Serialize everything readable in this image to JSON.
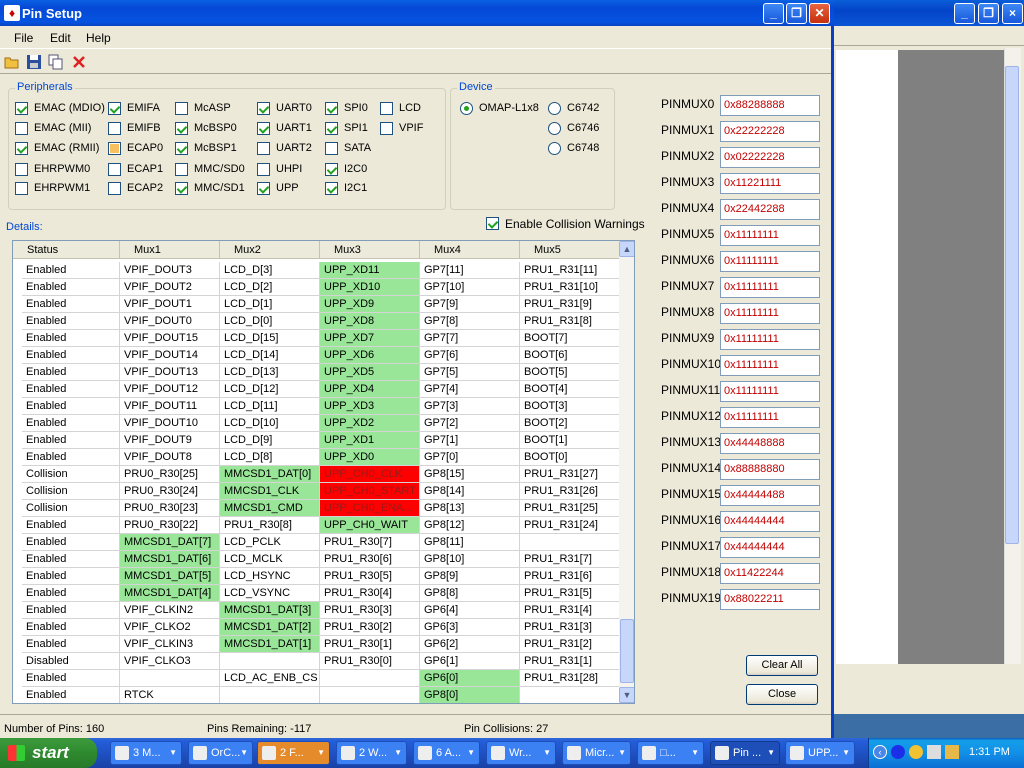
{
  "window": {
    "title": "Pin Setup"
  },
  "menu": {
    "items": [
      "File",
      "Edit",
      "Help"
    ]
  },
  "toolbar": {
    "icons": [
      "open-icon",
      "save-icon",
      "copy-icon",
      "delete-icon"
    ]
  },
  "peripherals": {
    "title": "Peripherals",
    "items": [
      {
        "label": "EMAC (MDIO)",
        "state": "checked"
      },
      {
        "label": "EMIFA",
        "state": "checked"
      },
      {
        "label": "McASP",
        "state": "unchecked"
      },
      {
        "label": "UART0",
        "state": "checked"
      },
      {
        "label": "SPI0",
        "state": "checked"
      },
      {
        "label": "LCD",
        "state": "unchecked"
      },
      {
        "label": "EMAC (MII)",
        "state": "unchecked"
      },
      {
        "label": "EMIFB",
        "state": "unchecked"
      },
      {
        "label": "McBSP0",
        "state": "checked"
      },
      {
        "label": "UART1",
        "state": "checked"
      },
      {
        "label": "SPI1",
        "state": "checked"
      },
      {
        "label": "VPIF",
        "state": "unchecked"
      },
      {
        "label": "EMAC (RMII)",
        "state": "checked"
      },
      {
        "label": "ECAP0",
        "state": "indeterminate"
      },
      {
        "label": "McBSP1",
        "state": "checked"
      },
      {
        "label": "UART2",
        "state": "unchecked"
      },
      {
        "label": "SATA",
        "state": "unchecked"
      },
      {
        "label": "EHRPWM0",
        "state": "unchecked"
      },
      {
        "label": "ECAP1",
        "state": "unchecked"
      },
      {
        "label": "MMC/SD0",
        "state": "unchecked"
      },
      {
        "label": "UHPI",
        "state": "unchecked"
      },
      {
        "label": "I2C0",
        "state": "checked"
      },
      {
        "label": "EHRPWM1",
        "state": "unchecked"
      },
      {
        "label": "ECAP2",
        "state": "unchecked"
      },
      {
        "label": "MMC/SD1",
        "state": "checked"
      },
      {
        "label": "UPP",
        "state": "checked"
      },
      {
        "label": "I2C1",
        "state": "checked"
      }
    ]
  },
  "device": {
    "title": "Device",
    "options": [
      {
        "label": "OMAP-L1x8",
        "selected": true
      },
      {
        "label": "C6742",
        "selected": false
      },
      {
        "label": "C6746",
        "selected": false
      },
      {
        "label": "C6748",
        "selected": false
      }
    ]
  },
  "details": {
    "label": "Details:"
  },
  "collision": {
    "label": "Enable Collision Warnings",
    "checked": true
  },
  "grid": {
    "headers": [
      "Status",
      "Mux1",
      "Mux2",
      "Mux3",
      "Mux4",
      "Mux5"
    ],
    "rows": [
      [
        [
          "Enabled",
          ""
        ],
        [
          "VPIF_DOUT3",
          ""
        ],
        [
          "LCD_D[3]",
          ""
        ],
        [
          "UPP_XD11",
          "g"
        ],
        [
          "GP7[11]",
          ""
        ],
        [
          "PRU1_R31[11]",
          ""
        ]
      ],
      [
        [
          "Enabled",
          ""
        ],
        [
          "VPIF_DOUT2",
          ""
        ],
        [
          "LCD_D[2]",
          ""
        ],
        [
          "UPP_XD10",
          "g"
        ],
        [
          "GP7[10]",
          ""
        ],
        [
          "PRU1_R31[10]",
          ""
        ]
      ],
      [
        [
          "Enabled",
          ""
        ],
        [
          "VPIF_DOUT1",
          ""
        ],
        [
          "LCD_D[1]",
          ""
        ],
        [
          "UPP_XD9",
          "g"
        ],
        [
          "GP7[9]",
          ""
        ],
        [
          "PRU1_R31[9]",
          ""
        ]
      ],
      [
        [
          "Enabled",
          ""
        ],
        [
          "VPIF_DOUT0",
          ""
        ],
        [
          "LCD_D[0]",
          ""
        ],
        [
          "UPP_XD8",
          "g"
        ],
        [
          "GP7[8]",
          ""
        ],
        [
          "PRU1_R31[8]",
          ""
        ]
      ],
      [
        [
          "Enabled",
          ""
        ],
        [
          "VPIF_DOUT15",
          ""
        ],
        [
          "LCD_D[15]",
          ""
        ],
        [
          "UPP_XD7",
          "g"
        ],
        [
          "GP7[7]",
          ""
        ],
        [
          "BOOT[7]",
          ""
        ]
      ],
      [
        [
          "Enabled",
          ""
        ],
        [
          "VPIF_DOUT14",
          ""
        ],
        [
          "LCD_D[14]",
          ""
        ],
        [
          "UPP_XD6",
          "g"
        ],
        [
          "GP7[6]",
          ""
        ],
        [
          "BOOT[6]",
          ""
        ]
      ],
      [
        [
          "Enabled",
          ""
        ],
        [
          "VPIF_DOUT13",
          ""
        ],
        [
          "LCD_D[13]",
          ""
        ],
        [
          "UPP_XD5",
          "g"
        ],
        [
          "GP7[5]",
          ""
        ],
        [
          "BOOT[5]",
          ""
        ]
      ],
      [
        [
          "Enabled",
          ""
        ],
        [
          "VPIF_DOUT12",
          ""
        ],
        [
          "LCD_D[12]",
          ""
        ],
        [
          "UPP_XD4",
          "g"
        ],
        [
          "GP7[4]",
          ""
        ],
        [
          "BOOT[4]",
          ""
        ]
      ],
      [
        [
          "Enabled",
          ""
        ],
        [
          "VPIF_DOUT11",
          ""
        ],
        [
          "LCD_D[11]",
          ""
        ],
        [
          "UPP_XD3",
          "g"
        ],
        [
          "GP7[3]",
          ""
        ],
        [
          "BOOT[3]",
          ""
        ]
      ],
      [
        [
          "Enabled",
          ""
        ],
        [
          "VPIF_DOUT10",
          ""
        ],
        [
          "LCD_D[10]",
          ""
        ],
        [
          "UPP_XD2",
          "g"
        ],
        [
          "GP7[2]",
          ""
        ],
        [
          "BOOT[2]",
          ""
        ]
      ],
      [
        [
          "Enabled",
          ""
        ],
        [
          "VPIF_DOUT9",
          ""
        ],
        [
          "LCD_D[9]",
          ""
        ],
        [
          "UPP_XD1",
          "g"
        ],
        [
          "GP7[1]",
          ""
        ],
        [
          "BOOT[1]",
          ""
        ]
      ],
      [
        [
          "Enabled",
          ""
        ],
        [
          "VPIF_DOUT8",
          ""
        ],
        [
          "LCD_D[8]",
          ""
        ],
        [
          "UPP_XD0",
          "g"
        ],
        [
          "GP7[0]",
          ""
        ],
        [
          "BOOT[0]",
          ""
        ]
      ],
      [
        [
          "Collision",
          ""
        ],
        [
          "PRU0_R30[25]",
          ""
        ],
        [
          "MMCSD1_DAT[0]",
          "g"
        ],
        [
          "UPP_CH0_CLK",
          "r"
        ],
        [
          "GP8[15]",
          ""
        ],
        [
          "PRU1_R31[27]",
          ""
        ]
      ],
      [
        [
          "Collision",
          ""
        ],
        [
          "PRU0_R30[24]",
          ""
        ],
        [
          "MMCSD1_CLK",
          "g"
        ],
        [
          "UPP_CH0_START",
          "r"
        ],
        [
          "GP8[14]",
          ""
        ],
        [
          "PRU1_R31[26]",
          ""
        ]
      ],
      [
        [
          "Collision",
          ""
        ],
        [
          "PRU0_R30[23]",
          ""
        ],
        [
          "MMCSD1_CMD",
          "g"
        ],
        [
          "UPP_CH0_ENA...",
          "r"
        ],
        [
          "GP8[13]",
          ""
        ],
        [
          "PRU1_R31[25]",
          ""
        ]
      ],
      [
        [
          "Enabled",
          ""
        ],
        [
          "PRU0_R30[22]",
          ""
        ],
        [
          "PRU1_R30[8]",
          ""
        ],
        [
          "UPP_CH0_WAIT",
          "g"
        ],
        [
          "GP8[12]",
          ""
        ],
        [
          "PRU1_R31[24]",
          ""
        ]
      ],
      [
        [
          "Enabled",
          ""
        ],
        [
          "MMCSD1_DAT[7]",
          "g"
        ],
        [
          "LCD_PCLK",
          ""
        ],
        [
          "PRU1_R30[7]",
          ""
        ],
        [
          "GP8[11]",
          ""
        ],
        [
          "",
          ""
        ]
      ],
      [
        [
          "Enabled",
          ""
        ],
        [
          "MMCSD1_DAT[6]",
          "g"
        ],
        [
          "LCD_MCLK",
          ""
        ],
        [
          "PRU1_R30[6]",
          ""
        ],
        [
          "GP8[10]",
          ""
        ],
        [
          "PRU1_R31[7]",
          ""
        ]
      ],
      [
        [
          "Enabled",
          ""
        ],
        [
          "MMCSD1_DAT[5]",
          "g"
        ],
        [
          "LCD_HSYNC",
          ""
        ],
        [
          "PRU1_R30[5]",
          ""
        ],
        [
          "GP8[9]",
          ""
        ],
        [
          "PRU1_R31[6]",
          ""
        ]
      ],
      [
        [
          "Enabled",
          ""
        ],
        [
          "MMCSD1_DAT[4]",
          "g"
        ],
        [
          "LCD_VSYNC",
          ""
        ],
        [
          "PRU1_R30[4]",
          ""
        ],
        [
          "GP8[8]",
          ""
        ],
        [
          "PRU1_R31[5]",
          ""
        ]
      ],
      [
        [
          "Enabled",
          ""
        ],
        [
          "VPIF_CLKIN2",
          ""
        ],
        [
          "MMCSD1_DAT[3]",
          "g"
        ],
        [
          "PRU1_R30[3]",
          ""
        ],
        [
          "GP6[4]",
          ""
        ],
        [
          "PRU1_R31[4]",
          ""
        ]
      ],
      [
        [
          "Enabled",
          ""
        ],
        [
          "VPIF_CLKO2",
          ""
        ],
        [
          "MMCSD1_DAT[2]",
          "g"
        ],
        [
          "PRU1_R30[2]",
          ""
        ],
        [
          "GP6[3]",
          ""
        ],
        [
          "PRU1_R31[3]",
          ""
        ]
      ],
      [
        [
          "Enabled",
          ""
        ],
        [
          "VPIF_CLKIN3",
          ""
        ],
        [
          "MMCSD1_DAT[1]",
          "g"
        ],
        [
          "PRU1_R30[1]",
          ""
        ],
        [
          "GP6[2]",
          ""
        ],
        [
          "PRU1_R31[2]",
          ""
        ]
      ],
      [
        [
          "Disabled",
          ""
        ],
        [
          "VPIF_CLKO3",
          ""
        ],
        [
          "",
          ""
        ],
        [
          "PRU1_R30[0]",
          ""
        ],
        [
          "GP6[1]",
          ""
        ],
        [
          "PRU1_R31[1]",
          ""
        ]
      ],
      [
        [
          "Enabled",
          ""
        ],
        [
          "",
          ""
        ],
        [
          "LCD_AC_ENB_CS",
          ""
        ],
        [
          "",
          ""
        ],
        [
          "GP6[0]",
          "g"
        ],
        [
          "PRU1_R31[28]",
          ""
        ]
      ],
      [
        [
          "Enabled",
          ""
        ],
        [
          "RTCK",
          ""
        ],
        [
          "",
          ""
        ],
        [
          "",
          ""
        ],
        [
          "GP8[0]",
          "g"
        ],
        [
          "",
          ""
        ]
      ]
    ]
  },
  "pinmux": [
    {
      "label": "PINMUX0",
      "value": "0x88288888"
    },
    {
      "label": "PINMUX1",
      "value": "0x22222228"
    },
    {
      "label": "PINMUX2",
      "value": "0x02222228"
    },
    {
      "label": "PINMUX3",
      "value": "0x11221111"
    },
    {
      "label": "PINMUX4",
      "value": "0x22442288"
    },
    {
      "label": "PINMUX5",
      "value": "0x11111111"
    },
    {
      "label": "PINMUX6",
      "value": "0x11111111"
    },
    {
      "label": "PINMUX7",
      "value": "0x11111111"
    },
    {
      "label": "PINMUX8",
      "value": "0x11111111"
    },
    {
      "label": "PINMUX9",
      "value": "0x11111111"
    },
    {
      "label": "PINMUX10",
      "value": "0x11111111"
    },
    {
      "label": "PINMUX11",
      "value": "0x11111111"
    },
    {
      "label": "PINMUX12",
      "value": "0x11111111"
    },
    {
      "label": "PINMUX13",
      "value": "0x44448888"
    },
    {
      "label": "PINMUX14",
      "value": "0x88888880"
    },
    {
      "label": "PINMUX15",
      "value": "0x44444488"
    },
    {
      "label": "PINMUX16",
      "value": "0x44444444"
    },
    {
      "label": "PINMUX17",
      "value": "0x44444444"
    },
    {
      "label": "PINMUX18",
      "value": "0x11422244"
    },
    {
      "label": "PINMUX19",
      "value": "0x88022211"
    }
  ],
  "buttons": {
    "clear_all": "Clear All",
    "close": "Close"
  },
  "status": {
    "pins": "Number of Pins: 160",
    "remaining": "Pins Remaining: -117",
    "collisions": "Pin Collisions: 27"
  },
  "taskbar": {
    "start": "start",
    "tasks": [
      {
        "label": "3 M...",
        "icon": "folder-icon",
        "active": false,
        "orange": false
      },
      {
        "label": "OrC...",
        "icon": "app-icon",
        "active": false,
        "orange": false
      },
      {
        "label": "2 F...",
        "icon": "firefox-icon",
        "active": false,
        "orange": true
      },
      {
        "label": "2 W...",
        "icon": "folder-icon",
        "active": false,
        "orange": false
      },
      {
        "label": "6 A...",
        "icon": "pdf-icon",
        "active": false,
        "orange": false
      },
      {
        "label": "Wr...",
        "icon": "app-icon",
        "active": false,
        "orange": false
      },
      {
        "label": "Micr...",
        "icon": "excel-icon",
        "active": false,
        "orange": false
      },
      {
        "label": "□...",
        "icon": "ie-icon",
        "active": false,
        "orange": false
      },
      {
        "label": "Pin ...",
        "icon": "ti-icon",
        "active": true,
        "orange": false
      },
      {
        "label": "UPP...",
        "icon": "app-icon",
        "active": false,
        "orange": false
      }
    ],
    "clock": "1:31 PM"
  },
  "colors": {
    "green": "#99e699",
    "red": "#ff0000",
    "title_blue": "#0548d6"
  }
}
